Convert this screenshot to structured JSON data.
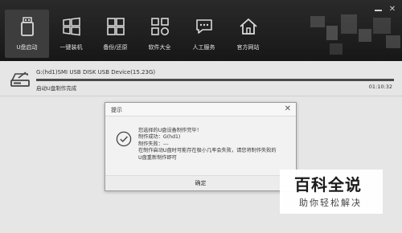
{
  "toolbar": {
    "items": [
      {
        "label": "U盘启动",
        "icon": "usb-drive-icon",
        "active": true
      },
      {
        "label": "一键装机",
        "icon": "windows-logo-icon",
        "active": false
      },
      {
        "label": "备份/还原",
        "icon": "backup-restore-icon",
        "active": false
      },
      {
        "label": "软件大全",
        "icon": "app-grid-icon",
        "active": false
      },
      {
        "label": "人工服务",
        "icon": "chat-bubble-icon",
        "active": false
      },
      {
        "label": "官方网站",
        "icon": "home-icon",
        "active": false
      }
    ]
  },
  "device": {
    "name": "G:(hd1)SMI USB DISK USB Device(15.23G)",
    "status": "启动U盘制作完成",
    "time": "01:10:32",
    "progress": 1.0
  },
  "dialog": {
    "title": "提示",
    "lines": [
      "您选择的U盘设备制作完毕！",
      "制作成功：G(hd1)",
      "制作失败：---",
      "在制作启动U盘时可能存在极小几率会失败，请您将制作失败的",
      "U盘重新制作即可"
    ],
    "ok_label": "确定"
  },
  "watermark": {
    "main": "百科全说",
    "sub": "助你轻松解决"
  },
  "colors": {
    "toolbar_bg": "#1f1f1f",
    "body_bg": "#e6e6e6",
    "dialog_bg": "#f2f2f2"
  }
}
